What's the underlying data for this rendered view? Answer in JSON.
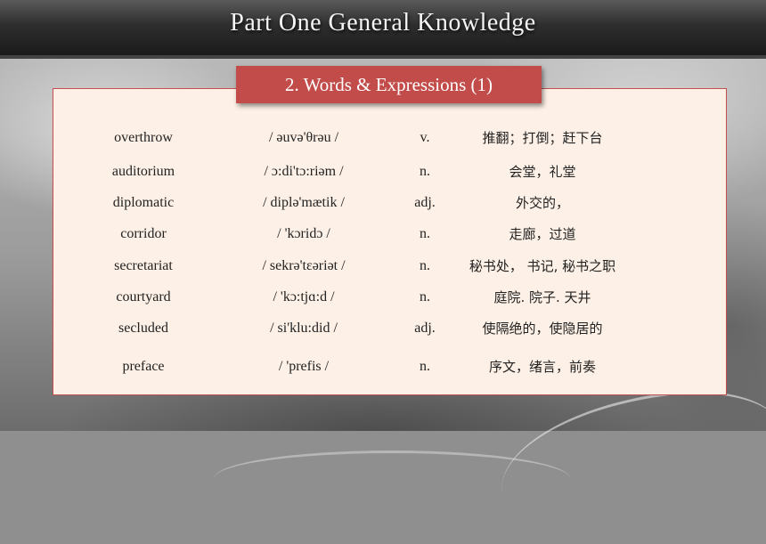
{
  "header": {
    "title": "Part One  General Knowledge"
  },
  "section": {
    "label": "2. Words & Expressions (1)"
  },
  "vocabulary": [
    {
      "word": "overthrow",
      "phonetic": "/ əuvə'θrəu /",
      "pos": "v.",
      "meaning": "推翻；打倒；赶下台"
    },
    {
      "word": "auditorium",
      "phonetic": "/ ɔ:di'tɔ:riəm /",
      "pos": "n.",
      "meaning": "会堂，礼堂"
    },
    {
      "word": "diplomatic",
      "phonetic": "/ diplə'mætik /",
      "pos": "adj.",
      "meaning": "外交的，"
    },
    {
      "word": "corridor",
      "phonetic": "/ 'kɔridɔ /",
      "pos": "n.",
      "meaning": "走廊，过道"
    },
    {
      "word": "secretariat",
      "phonetic": "/ sekrə'tεəriət /",
      "pos": "n.",
      "meaning": "秘书处， 书记, 秘书之职"
    },
    {
      "word": "courtyard",
      "phonetic": "/ 'kɔ:tjɑ:d /",
      "pos": "n.",
      "meaning": "庭院. 院子. 天井"
    },
    {
      "word": "secluded",
      "phonetic": "/ si'klu:did /",
      "pos": "adj.",
      "meaning": "使隔绝的，使隐居的"
    },
    {
      "word": "preface",
      "phonetic": "/ 'prefis /",
      "pos": "n.",
      "meaning": "序文，绪言，前奏"
    }
  ]
}
